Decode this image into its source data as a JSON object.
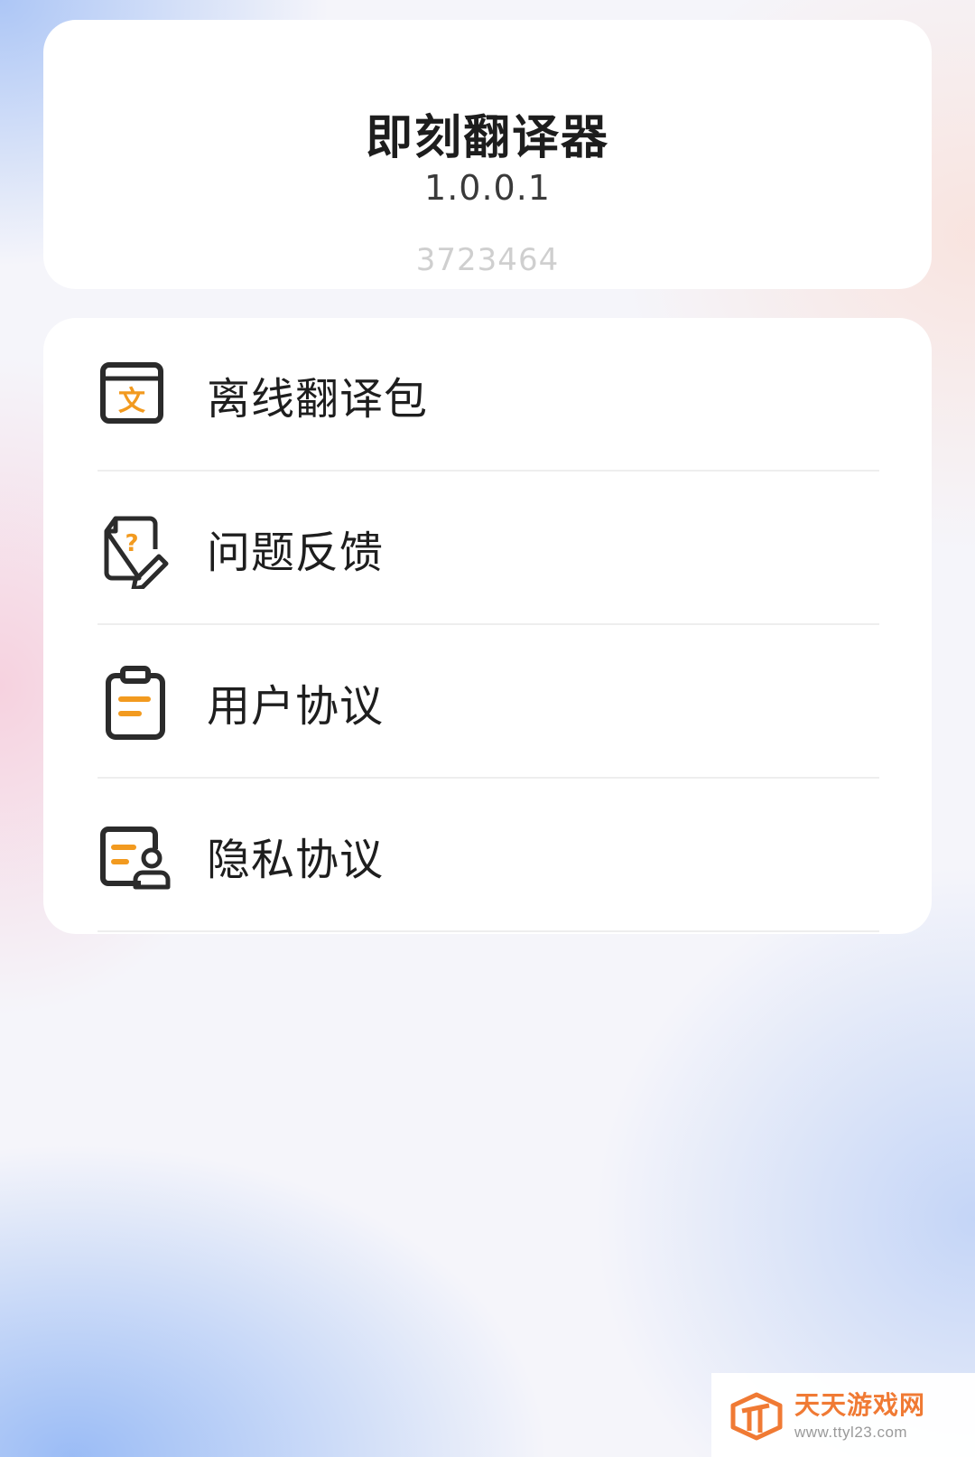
{
  "app": {
    "name": "即刻翻译器",
    "version": "1.0.0.1",
    "build": "3723464"
  },
  "menu": {
    "items": [
      {
        "label": "离线翻译包",
        "icon": "offline-package-icon"
      },
      {
        "label": "问题反馈",
        "icon": "feedback-icon"
      },
      {
        "label": "用户协议",
        "icon": "clipboard-icon"
      },
      {
        "label": "隐私协议",
        "icon": "privacy-icon"
      }
    ]
  },
  "watermark": {
    "title": "天天游戏网",
    "url": "www.ttyl23.com"
  },
  "colors": {
    "accent": "#f29a1f",
    "icon_stroke": "#2b2b2b",
    "watermark": "#f07a34"
  }
}
